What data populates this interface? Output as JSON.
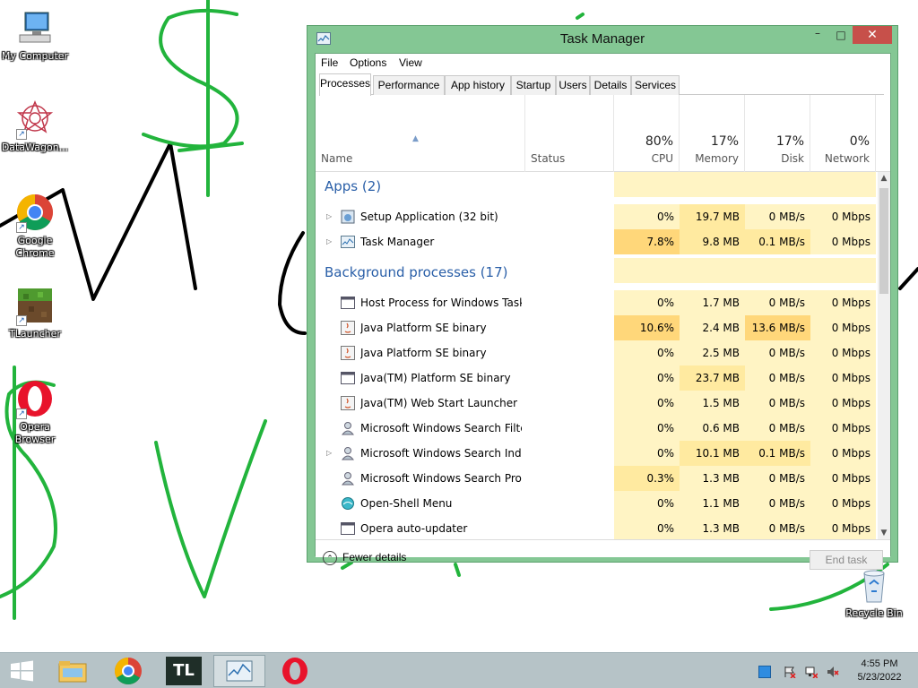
{
  "desktop": {
    "icons": [
      {
        "label": "My Computer",
        "icon": "computer-icon"
      },
      {
        "label": "DataWagon...",
        "icon": "datawagon-icon"
      },
      {
        "label": "Google Chrome",
        "icon": "chrome-icon"
      },
      {
        "label": "TLauncher",
        "icon": "tlauncher-icon"
      },
      {
        "label": "Opera Browser",
        "icon": "opera-icon"
      },
      {
        "label": "Recycle Bin",
        "icon": "recycle-bin-icon"
      }
    ]
  },
  "window": {
    "title": "Task Manager",
    "minimize": "–",
    "maximize": "□",
    "close": "✕",
    "menu": [
      "File",
      "Options",
      "View"
    ],
    "tabs": [
      "Processes",
      "Performance",
      "App history",
      "Startup",
      "Users",
      "Details",
      "Services"
    ],
    "active_tab": "Processes",
    "columns": {
      "name": "Name",
      "status": "Status",
      "cpu": {
        "pct": "80%",
        "label": "CPU"
      },
      "memory": {
        "pct": "17%",
        "label": "Memory"
      },
      "disk": {
        "pct": "17%",
        "label": "Disk"
      },
      "network": {
        "pct": "0%",
        "label": "Network"
      }
    },
    "groups": [
      {
        "name": "Apps (2)",
        "rows": [
          {
            "name": "Setup Application (32 bit)",
            "expandable": true,
            "icon": "setup-icon",
            "cpu": "0%",
            "memory": "19.7 MB",
            "disk": "0 MB/s",
            "network": "0 Mbps"
          },
          {
            "name": "Task Manager",
            "expandable": true,
            "icon": "taskmanager-icon",
            "cpu": "7.8%",
            "memory": "9.8 MB",
            "disk": "0.1 MB/s",
            "network": "0 Mbps"
          }
        ]
      },
      {
        "name": "Background processes (17)",
        "rows": [
          {
            "name": "Host Process for Windows Tasks",
            "expandable": false,
            "icon": "window-icon",
            "cpu": "0%",
            "memory": "1.7 MB",
            "disk": "0 MB/s",
            "network": "0 Mbps"
          },
          {
            "name": "Java Platform SE binary",
            "expandable": false,
            "icon": "java-icon",
            "cpu": "10.6%",
            "memory": "2.4 MB",
            "disk": "13.6 MB/s",
            "network": "0 Mbps"
          },
          {
            "name": "Java Platform SE binary",
            "expandable": false,
            "icon": "java-icon",
            "cpu": "0%",
            "memory": "2.5 MB",
            "disk": "0 MB/s",
            "network": "0 Mbps"
          },
          {
            "name": "Java(TM) Platform SE binary",
            "expandable": false,
            "icon": "window-icon",
            "cpu": "0%",
            "memory": "23.7 MB",
            "disk": "0 MB/s",
            "network": "0 Mbps"
          },
          {
            "name": "Java(TM) Web Start Launcher",
            "expandable": false,
            "icon": "java-icon",
            "cpu": "0%",
            "memory": "1.5 MB",
            "disk": "0 MB/s",
            "network": "0 Mbps"
          },
          {
            "name": "Microsoft Windows Search Filte...",
            "expandable": false,
            "icon": "search-service-icon",
            "cpu": "0%",
            "memory": "0.6 MB",
            "disk": "0 MB/s",
            "network": "0 Mbps"
          },
          {
            "name": "Microsoft Windows Search Inde...",
            "expandable": true,
            "icon": "search-service-icon",
            "cpu": "0%",
            "memory": "10.1 MB",
            "disk": "0.1 MB/s",
            "network": "0 Mbps"
          },
          {
            "name": "Microsoft Windows Search Prot...",
            "expandable": false,
            "icon": "search-service-icon",
            "cpu": "0.3%",
            "memory": "1.3 MB",
            "disk": "0 MB/s",
            "network": "0 Mbps"
          },
          {
            "name": "Open-Shell Menu",
            "expandable": false,
            "icon": "shell-icon",
            "cpu": "0%",
            "memory": "1.1 MB",
            "disk": "0 MB/s",
            "network": "0 Mbps"
          },
          {
            "name": "Opera auto-updater",
            "expandable": false,
            "icon": "window-icon",
            "cpu": "0%",
            "memory": "1.3 MB",
            "disk": "0 MB/s",
            "network": "0 Mbps"
          }
        ]
      }
    ],
    "footer": {
      "fewer_details": "Fewer details",
      "end_task": "End task"
    }
  },
  "taskbar": {
    "items": [
      {
        "name": "start-button",
        "icon": "windows-logo-icon"
      },
      {
        "name": "taskbar-explorer",
        "icon": "file-explorer-icon"
      },
      {
        "name": "taskbar-chrome",
        "icon": "chrome-icon"
      },
      {
        "name": "taskbar-tlauncher",
        "icon": "tlauncher-icon",
        "label": "TL"
      },
      {
        "name": "taskbar-taskmanager",
        "icon": "taskmanager-icon"
      },
      {
        "name": "taskbar-opera",
        "icon": "opera-icon"
      }
    ],
    "clock": {
      "time": "4:55 PM",
      "date": "5/23/2022"
    }
  },
  "colors": {
    "window_frame": "#84c794",
    "close_button": "#c7504a",
    "group_header": "#2a5fa8",
    "heat_low": "#fff4c4",
    "heat_mid": "#ffeaa0",
    "heat_high": "#ffd77a",
    "doodle_green": "#22b43c",
    "doodle_black": "#000000"
  }
}
